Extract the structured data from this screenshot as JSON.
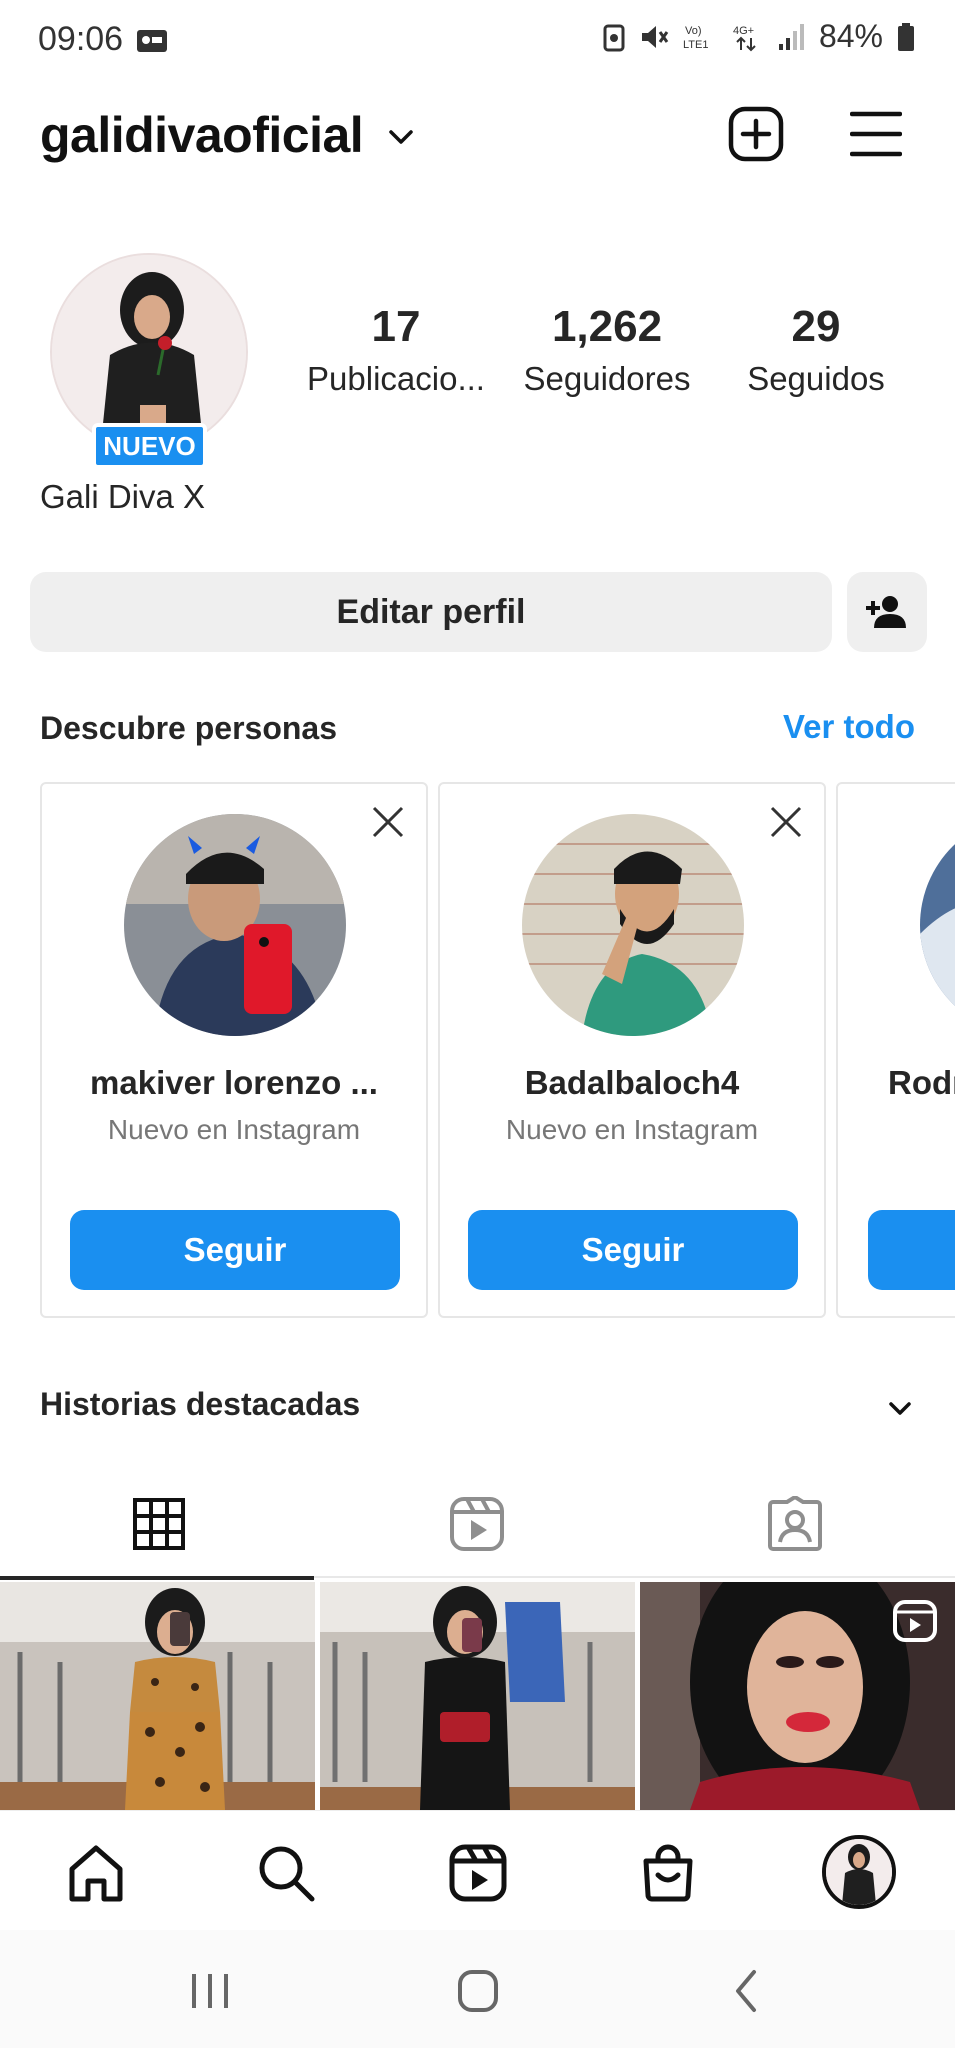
{
  "status": {
    "time": "09:06",
    "battery": "84%"
  },
  "header": {
    "username": "galidivaoficial"
  },
  "profile": {
    "badge": "NUEVO",
    "name": "Gali Diva X",
    "stats": [
      {
        "value": "17",
        "label": "Publicacio..."
      },
      {
        "value": "1,262",
        "label": "Seguidores"
      },
      {
        "value": "29",
        "label": "Seguidos"
      }
    ],
    "edit_label": "Editar perfil"
  },
  "discover": {
    "title": "Descubre personas",
    "see_all": "Ver todo",
    "cards": [
      {
        "name": "makiver lorenzo ...",
        "subtitle": "Nuevo en Instagram",
        "button": "Seguir"
      },
      {
        "name": "Badalbaloch4",
        "subtitle": "Nuevo en Instagram",
        "button": "Seguir"
      },
      {
        "name": "Rodr",
        "subtitle": "",
        "button": ""
      }
    ]
  },
  "highlights": {
    "title": "Historias destacadas"
  },
  "tabs": [
    "grid-icon",
    "reels-icon",
    "tagged-icon"
  ],
  "bottom_nav": [
    "home-icon",
    "search-icon",
    "reels-icon",
    "shop-icon",
    "profile-avatar"
  ],
  "colors": {
    "accent": "#1a8ff0",
    "text": "#262626",
    "button_bg": "#efefef"
  }
}
